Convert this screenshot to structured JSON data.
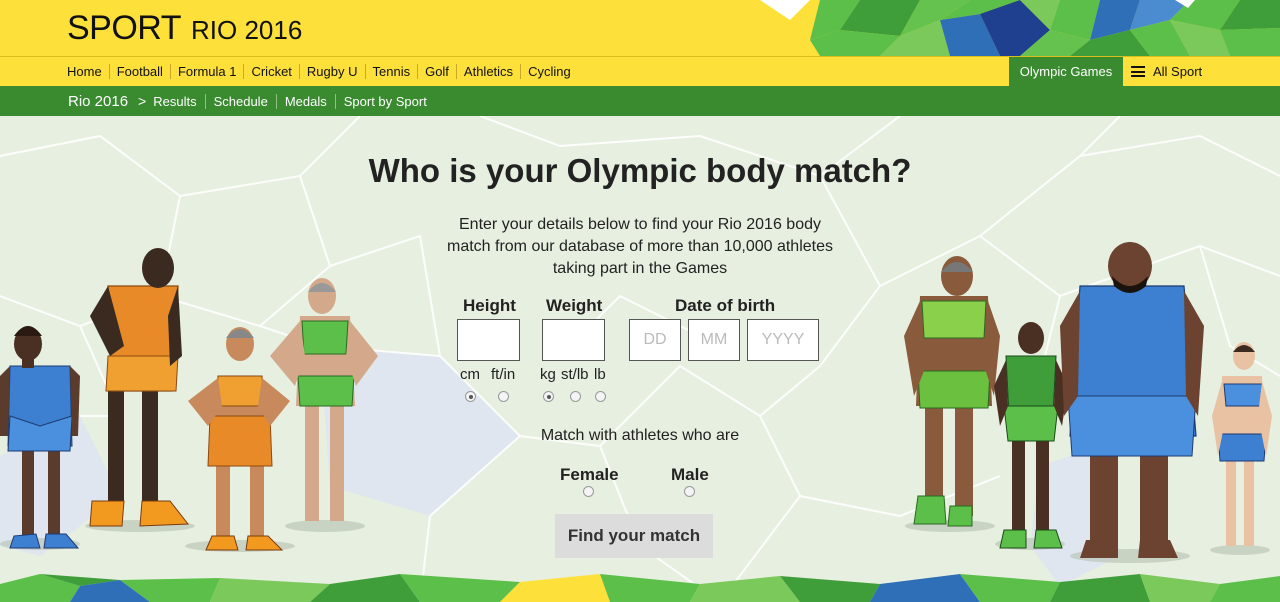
{
  "header": {
    "brand_sport": "SPORT",
    "brand_event": "RIO 2016"
  },
  "nav": {
    "items": [
      "Home",
      "Football",
      "Formula 1",
      "Cricket",
      "Rugby U",
      "Tennis",
      "Golf",
      "Athletics",
      "Cycling"
    ],
    "olympic_games": "Olympic Games",
    "all_sport": "All Sport"
  },
  "subnav": {
    "home": "Rio 2016",
    "separator": ">",
    "items": [
      "Results",
      "Schedule",
      "Medals",
      "Sport by Sport"
    ]
  },
  "main": {
    "title": "Who is your Olympic body match?",
    "intro": "Enter your details below to find your Rio 2016 body match from our database of more than 10,000 athletes taking part in the Games",
    "height": {
      "label": "Height",
      "value": "",
      "units": [
        "cm",
        "ft/in"
      ],
      "selected_unit": "cm"
    },
    "weight": {
      "label": "Weight",
      "value": "",
      "units": [
        "kg",
        "st/lb",
        "lb"
      ],
      "selected_unit": "kg"
    },
    "dob": {
      "label": "Date of birth",
      "day_placeholder": "DD",
      "month_placeholder": "MM",
      "year_placeholder": "YYYY"
    },
    "match_label": "Match with athletes who are",
    "gender_options": [
      "Female",
      "Male"
    ],
    "selected_gender": null,
    "submit_label": "Find your match"
  },
  "colors": {
    "yellow": "#fde03a",
    "green": "#3a8a30",
    "background": "#e6efe0",
    "button": "#dcdcdc"
  }
}
